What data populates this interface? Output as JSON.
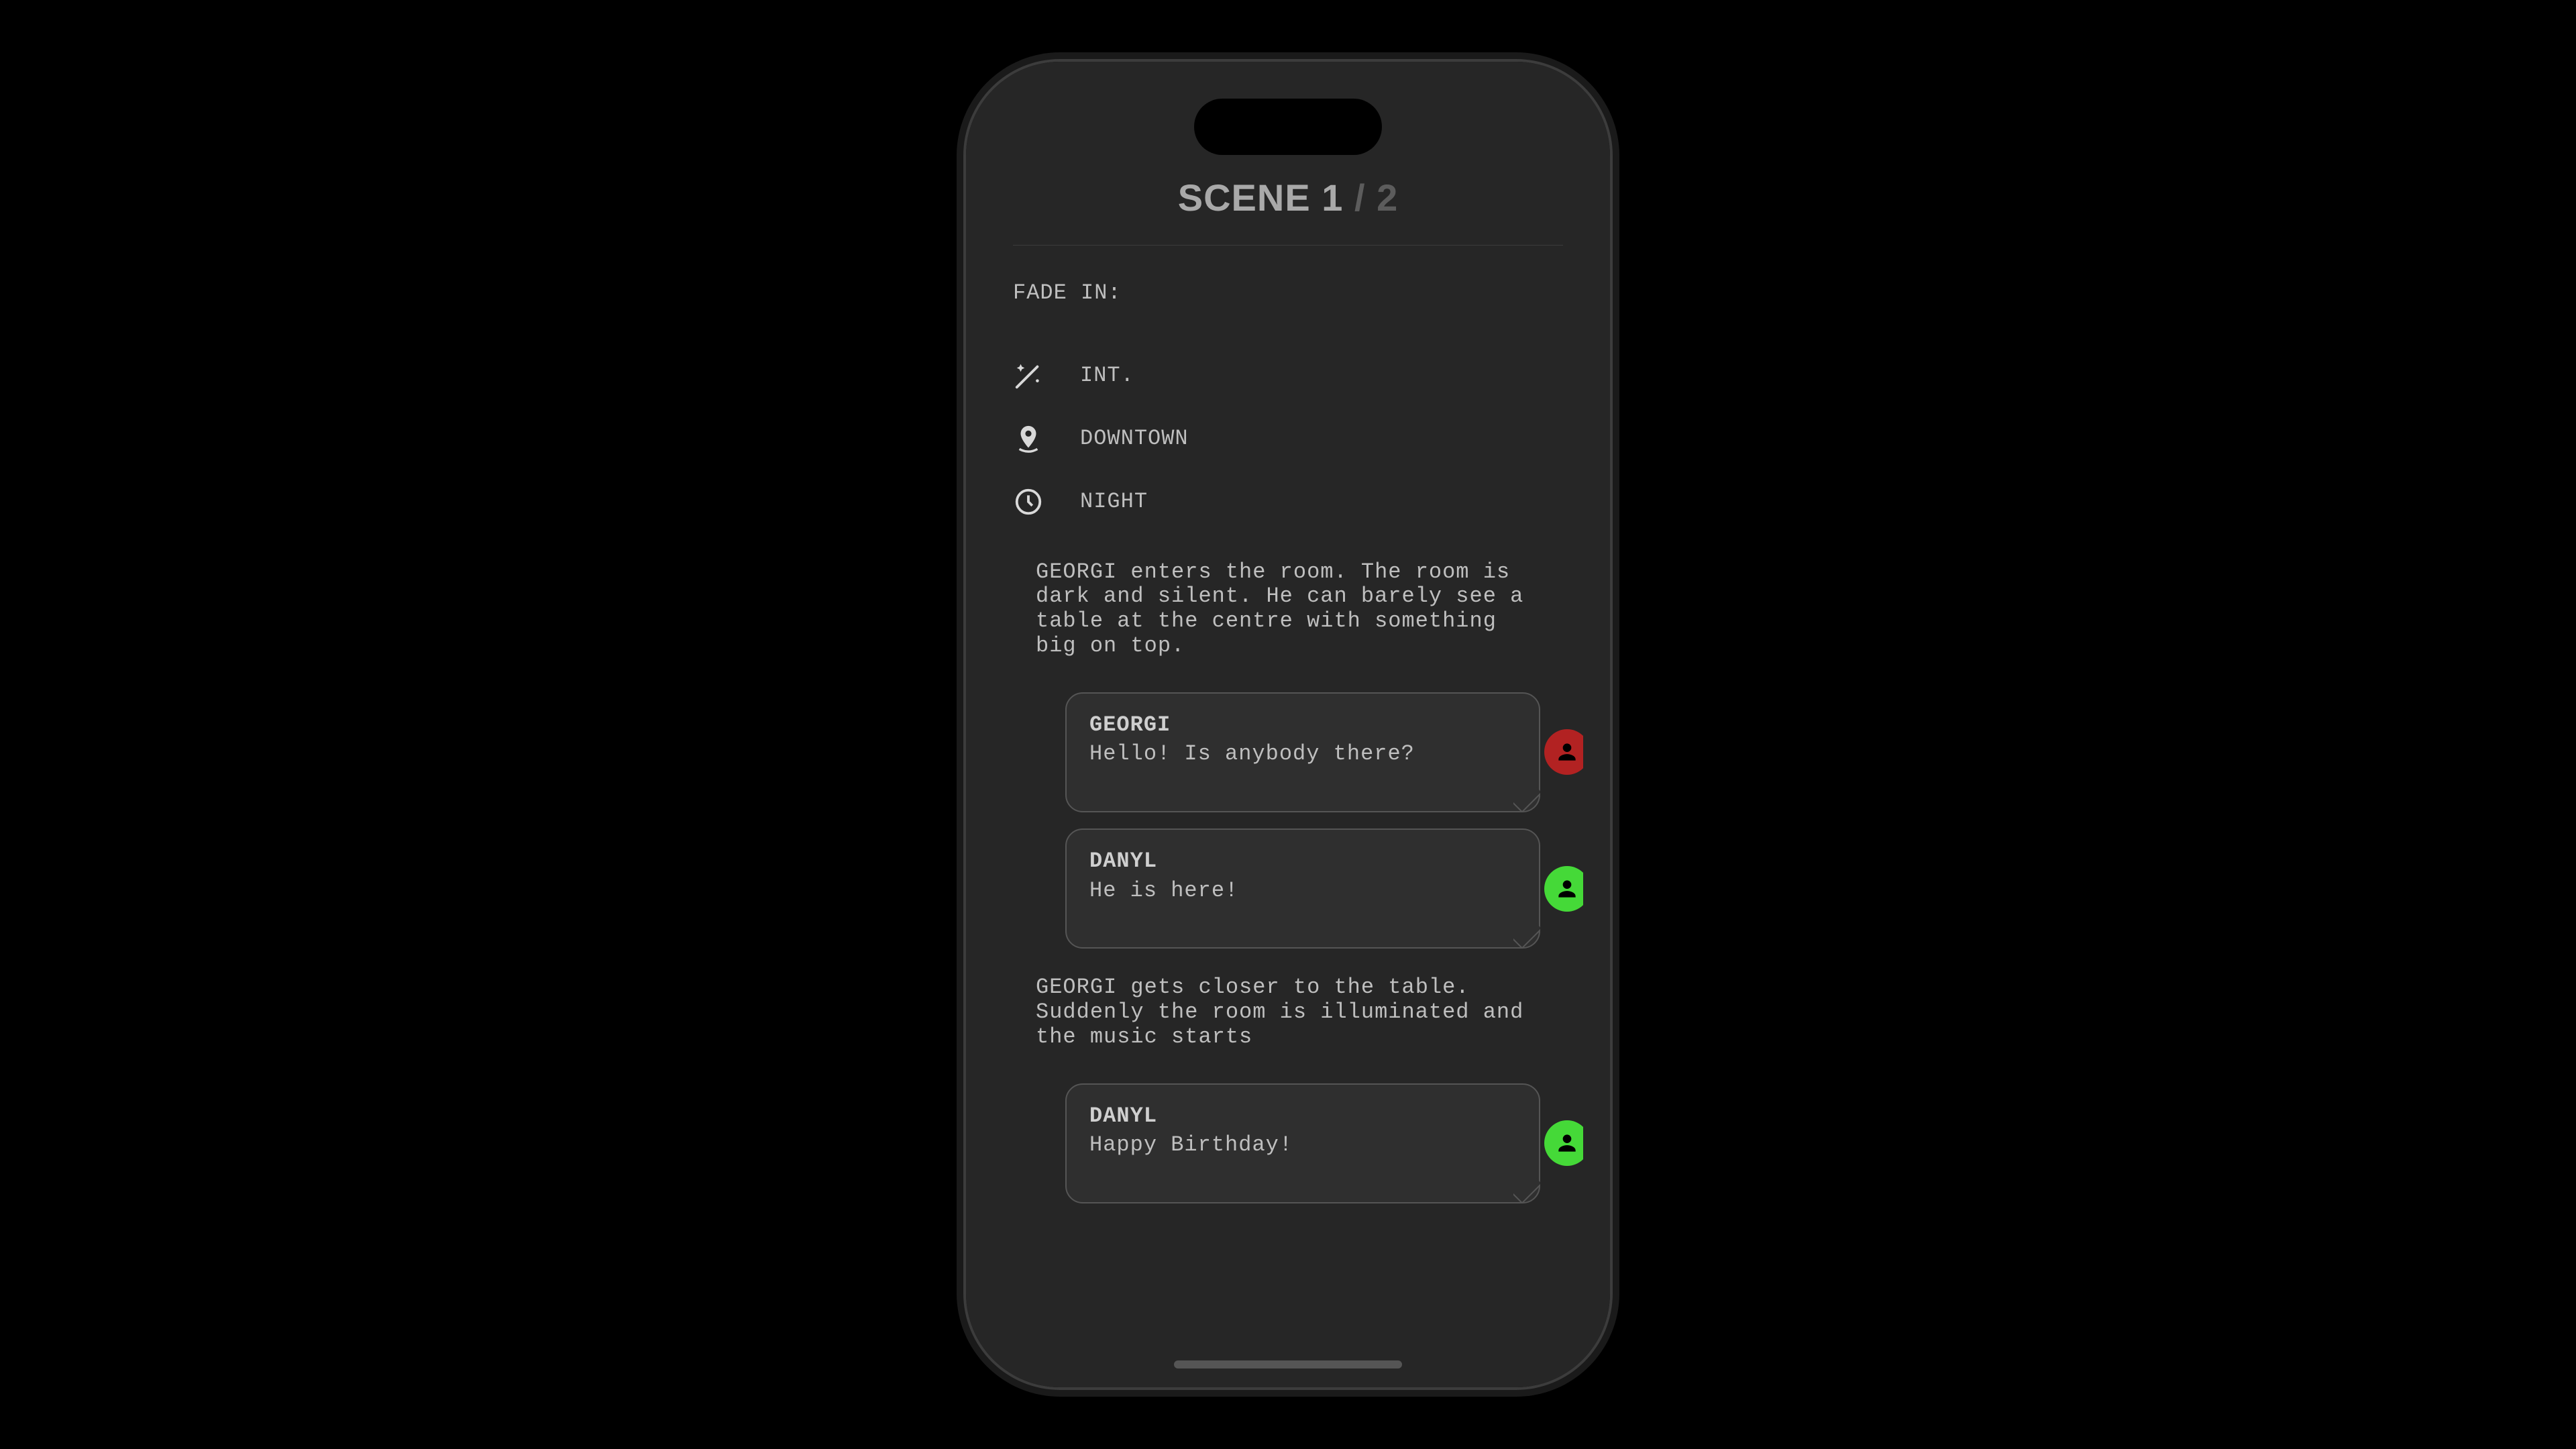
{
  "title": {
    "scene_label": "SCENE 1",
    "separator": " / ",
    "total": "2"
  },
  "fadein": "FADE IN:",
  "meta": {
    "interior": "INT.",
    "location": "DOWNTOWN",
    "time": "NIGHT"
  },
  "action1": "GEORGI enters the room. The room is dark and silent. He can barely see a table at the centre with something big on top.",
  "dialogs": [
    {
      "name": "GEORGI",
      "line": "Hello! Is anybody there?",
      "avatar_color": "#b22222"
    },
    {
      "name": "DANYL",
      "line": "He is here!",
      "avatar_color": "#45d938"
    }
  ],
  "action2": "GEORGI gets closer to the table. Suddenly the room is illuminated and the music starts",
  "dialogs2": [
    {
      "name": "DANYL",
      "line": "Happy Birthday!",
      "avatar_color": "#45d938"
    }
  ]
}
